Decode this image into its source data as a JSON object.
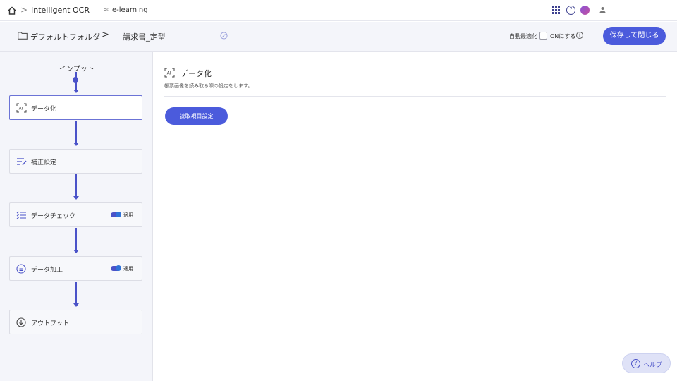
{
  "topbar": {
    "app_name": "Intelligent OCR",
    "separator": ">",
    "workspace_icon": "≈",
    "workspace": "e-learning",
    "user_icon": "user-icon"
  },
  "header": {
    "breadcrumb_root": "デフォルトフォルダ",
    "breadcrumb_sep": ">",
    "breadcrumb_current": "請求書_定型",
    "auto_optimize_label": "自動最適化",
    "auto_optimize_on_label": "ONにする",
    "save_close_label": "保存して閉じる"
  },
  "flow": {
    "input_label": "インプット",
    "steps": [
      {
        "label": "データ化",
        "icon": "ai-icon",
        "active": true
      },
      {
        "label": "補正設定",
        "icon": "correction-icon"
      },
      {
        "label": "データチェック",
        "icon": "checklist-icon",
        "toggle_label": "適用",
        "toggle_on": true
      },
      {
        "label": "データ加工",
        "icon": "process-icon",
        "toggle_label": "適用",
        "toggle_on": true
      },
      {
        "label": "アウトプット",
        "icon": "output-icon"
      }
    ]
  },
  "main": {
    "title": "データ化",
    "description": "帳票画像を読み取る際の設定をします。",
    "read_items_button": "読取項目設定"
  },
  "help": {
    "label": "ヘルプ",
    "icon_glyph": "?"
  },
  "colors": {
    "accent": "#4b5bdc",
    "flow": "#4a52c8",
    "panel": "#f4f5fa"
  }
}
